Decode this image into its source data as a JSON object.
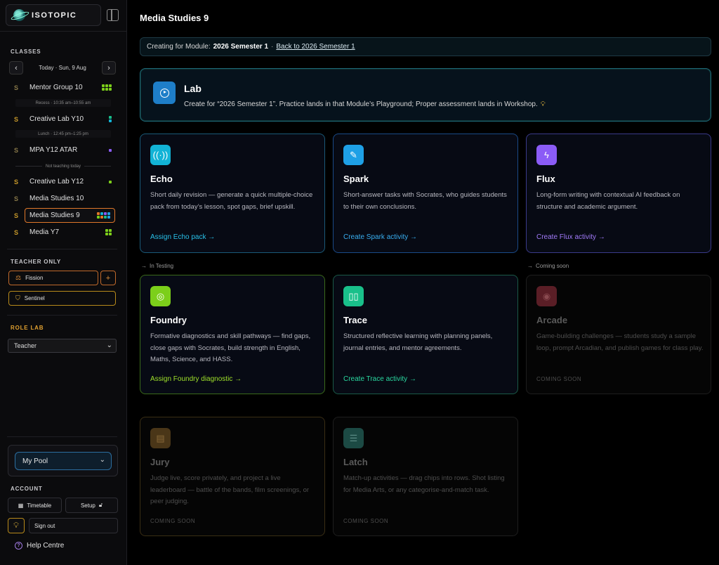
{
  "brand": {
    "name": "ISOTOPIC"
  },
  "page": {
    "title": "Media Studies 9"
  },
  "sidebar": {
    "classes_heading": "CLASSES",
    "day_label": "Today · Sun, 9 Aug",
    "classes": [
      {
        "s": "S",
        "name": "Mentor Group 10"
      },
      {
        "s": "S",
        "name": "Creative Lab Y10"
      },
      {
        "s": "S",
        "name": "MPA Y12 ATAR"
      },
      {
        "s": "S",
        "name": "Creative Lab Y12"
      },
      {
        "s": "S",
        "name": "Media Studies 10"
      },
      {
        "s": "S",
        "name": "Media Studies 9"
      },
      {
        "s": "S",
        "name": "Media Y7"
      }
    ],
    "recess": "Recess · 10:35 am–10:55 am",
    "lunch": "Lunch · 12:45 pm–1:25 pm",
    "not_teaching": "Not teaching today",
    "teacher_only_heading": "TEACHER ONLY",
    "fission_label": "Fission",
    "sentinel_label": "Sentinel",
    "role_lab_heading": "ROLE LAB",
    "role_select": "Teacher",
    "pool_select": "My Pool",
    "account_heading": "ACCOUNT",
    "timetable_label": "Timetable",
    "setup_label": "Setup",
    "signout_label": "Sign out",
    "help_label": "Help Centre"
  },
  "module_bar": {
    "prefix": "Creating for Module:",
    "module": "2026 Semester 1",
    "separator": "·",
    "back_link": "Back to 2026 Semester 1"
  },
  "lab": {
    "title": "Lab",
    "description": "Create for “2026 Semester 1”. Practice lands in that Module’s Playground; Proper assessment lands in Workshop."
  },
  "tags": {
    "in_testing": "In Testing",
    "coming_soon": "Coming soon"
  },
  "cards": {
    "echo": {
      "title": "Echo",
      "desc": "Short daily revision — generate a quick multiple-choice pack from today’s lesson, spot gaps, brief upskill.",
      "link": "Assign Echo pack"
    },
    "spark": {
      "title": "Spark",
      "desc": "Short-answer tasks with Socrates, who guides students to their own conclusions.",
      "link": "Create Spark activity"
    },
    "flux": {
      "title": "Flux",
      "desc": "Long-form writing with contextual AI feedback on structure and academic argument.",
      "link": "Create Flux activity"
    },
    "foundry": {
      "title": "Foundry",
      "desc": "Formative diagnostics and skill pathways — find gaps, close gaps with Socrates, build strength in English, Maths, Science, and HASS.",
      "link": "Assign Foundry diagnostic"
    },
    "trace": {
      "title": "Trace",
      "desc": "Structured reflective learning with planning panels, journal entries, and mentor agreements.",
      "link": "Create Trace activity"
    },
    "arcade": {
      "title": "Arcade",
      "desc": "Game-building challenges — students study a sample loop, prompt Arcadian, and publish games for class play.",
      "status": "COMING SOON"
    },
    "jury": {
      "title": "Jury",
      "desc": "Judge live, score privately, and project a live leaderboard — battle of the bands, film screenings, or peer judging.",
      "status": "COMING SOON"
    },
    "latch": {
      "title": "Latch",
      "desc": "Match-up activities — drag chips into rows. Shot listing for Media Arts, or any categorise-and-match task.",
      "status": "COMING SOON"
    }
  },
  "colors": {
    "echo": "#12b3d6",
    "spark": "#1ea0e6",
    "flux": "#8b5cf6",
    "foundry": "#7ccf1a",
    "trace": "#19c08a",
    "arcade": "#5a1e26",
    "jury": "#4a3618",
    "latch": "#1c4a44",
    "active_border": "#e0782a"
  },
  "arrow": "→"
}
